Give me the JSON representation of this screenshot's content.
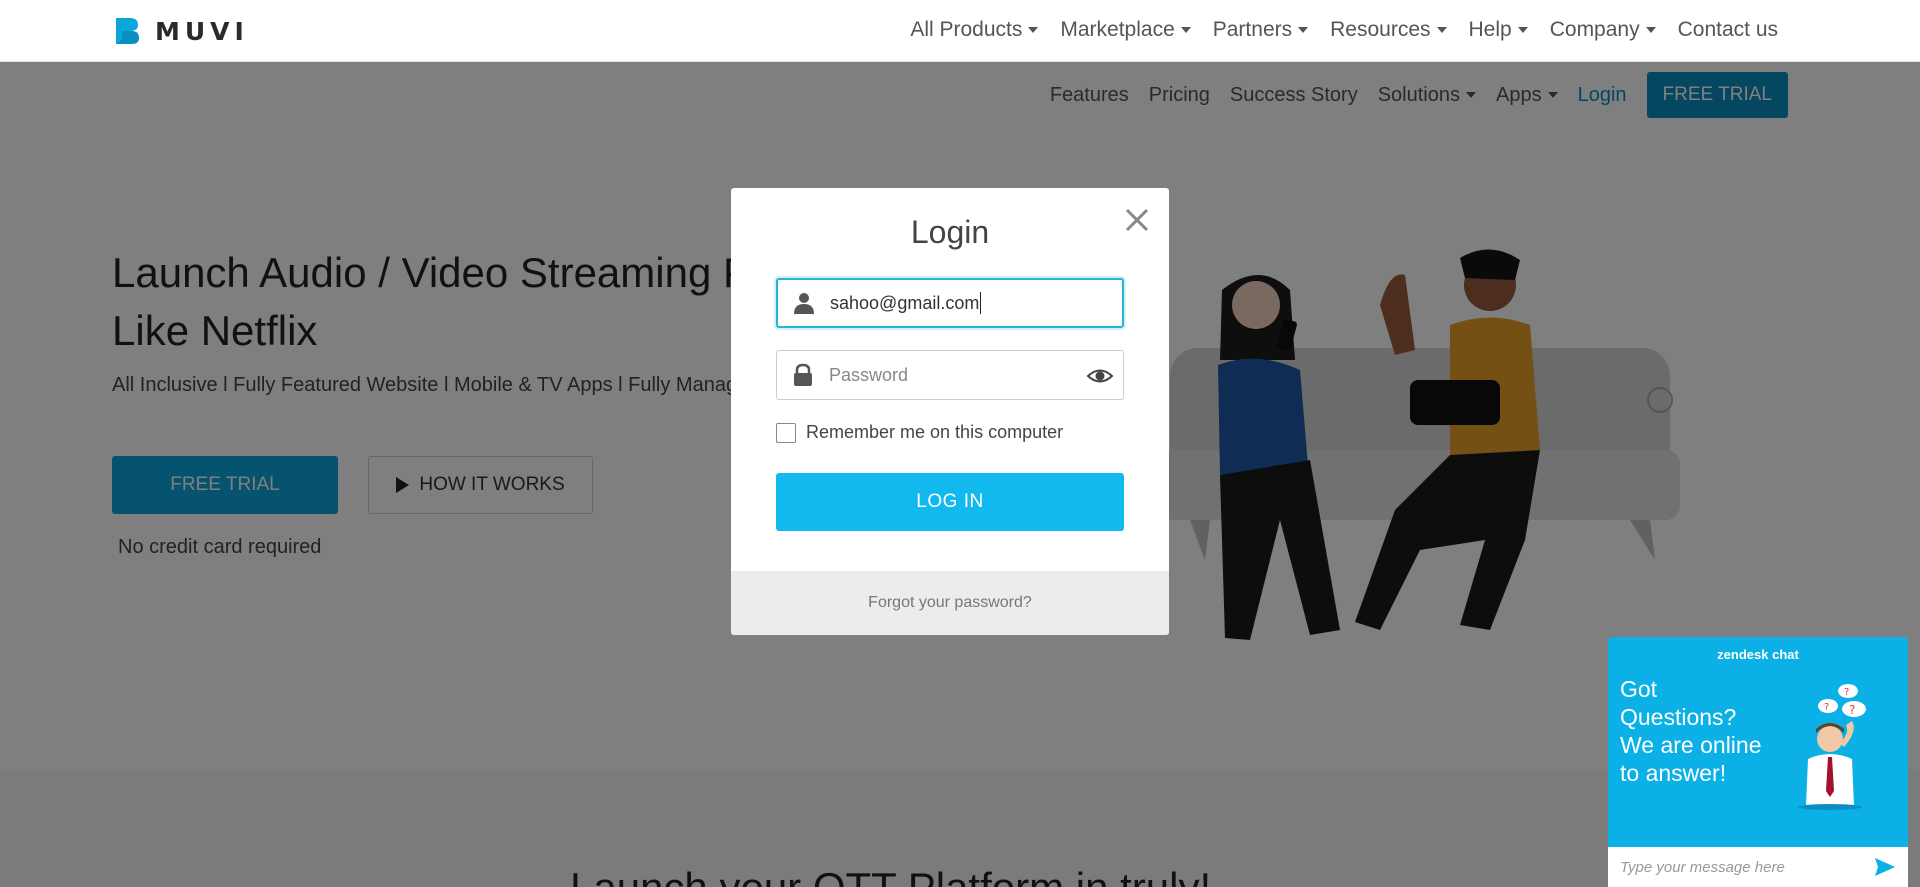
{
  "brand": {
    "name": "MUVI"
  },
  "top_nav": {
    "items": [
      {
        "label": "All Products",
        "dropdown": true
      },
      {
        "label": "Marketplace",
        "dropdown": true
      },
      {
        "label": "Partners",
        "dropdown": true
      },
      {
        "label": "Resources",
        "dropdown": true
      },
      {
        "label": "Help",
        "dropdown": true
      },
      {
        "label": "Company",
        "dropdown": true
      },
      {
        "label": "Contact us",
        "dropdown": false
      }
    ]
  },
  "sub_nav": {
    "features": "Features",
    "pricing": "Pricing",
    "success_story": "Success Story",
    "solutions": "Solutions",
    "apps": "Apps",
    "login": "Login",
    "free_trial": "FREE TRIAL"
  },
  "hero": {
    "title_line1": "Launch Audio / Video Streaming Platform",
    "title_line2": "Like Netflix",
    "subtitle": "All Inclusive l Fully Featured Website l Mobile & TV Apps l Fully Managed",
    "primary_button": "FREE TRIAL",
    "secondary_button": "HOW IT WORKS",
    "note": "No credit card required"
  },
  "section": {
    "heading": "Launch your OTT Platform in truly! "
  },
  "login_modal": {
    "title": "Login",
    "email_value": "sahoo@gmail.com",
    "password_placeholder": "Password",
    "remember_label": "Remember me on this computer",
    "remember_checked": false,
    "submit_label": "LOG IN",
    "forgot_label": "Forgot your password?"
  },
  "chat_widget": {
    "brand": "zendesk chat",
    "message": "Got Questions? We are online to answer!",
    "input_placeholder": "Type your message here"
  },
  "colors": {
    "accent": "#0a8fc2",
    "button_primary": "#12b9ee",
    "focus_border": "#27b4d9",
    "widget_bg": "#0ab0e6"
  },
  "icons": {
    "logo": "muvi-logo-icon",
    "close": "close-icon",
    "user": "user-icon",
    "lock": "lock-icon",
    "eye": "eye-icon",
    "play": "play-icon",
    "send": "send-icon"
  }
}
